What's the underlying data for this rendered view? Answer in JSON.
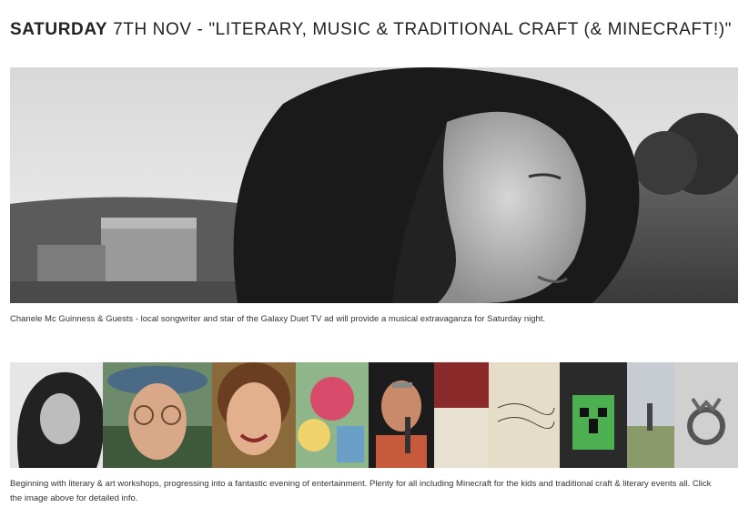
{
  "heading": {
    "day": "SATURDAY",
    "rest": " 7TH NOV - \"LITERARY, MUSIC & TRADITIONAL CRAFT (& MINECRAFT!)\""
  },
  "hero": {
    "caption": "Chanele Mc Guinness & Guests - local songwriter and star of the Galaxy Duet TV ad will provide a musical extravaganza for Saturday night."
  },
  "collage": {
    "caption": "Beginning with literary & art workshops, progressing into a fantastic evening of entertainment. Plenty for all including Minecraft for the kids and traditional craft & literary events all. Click the image above for detailed info."
  },
  "colors": {
    "background": "#ffffff",
    "heading": "#222222",
    "caption": "#333333"
  }
}
